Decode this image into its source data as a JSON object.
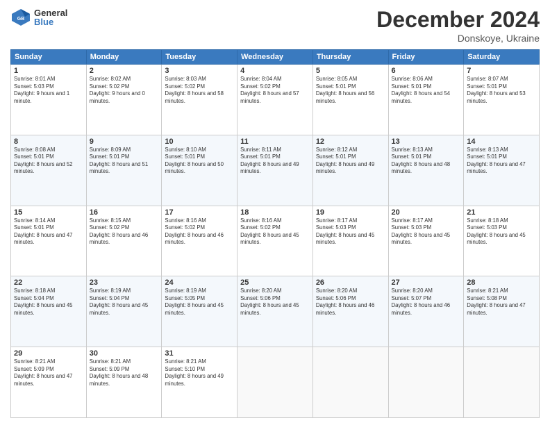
{
  "header": {
    "logo_general": "General",
    "logo_blue": "Blue",
    "title": "December 2024",
    "subtitle": "Donskoye, Ukraine"
  },
  "days_of_week": [
    "Sunday",
    "Monday",
    "Tuesday",
    "Wednesday",
    "Thursday",
    "Friday",
    "Saturday"
  ],
  "weeks": [
    [
      {
        "day": "1",
        "sunrise": "Sunrise: 8:01 AM",
        "sunset": "Sunset: 5:03 PM",
        "daylight": "Daylight: 9 hours and 1 minute."
      },
      {
        "day": "2",
        "sunrise": "Sunrise: 8:02 AM",
        "sunset": "Sunset: 5:02 PM",
        "daylight": "Daylight: 9 hours and 0 minutes."
      },
      {
        "day": "3",
        "sunrise": "Sunrise: 8:03 AM",
        "sunset": "Sunset: 5:02 PM",
        "daylight": "Daylight: 8 hours and 58 minutes."
      },
      {
        "day": "4",
        "sunrise": "Sunrise: 8:04 AM",
        "sunset": "Sunset: 5:02 PM",
        "daylight": "Daylight: 8 hours and 57 minutes."
      },
      {
        "day": "5",
        "sunrise": "Sunrise: 8:05 AM",
        "sunset": "Sunset: 5:01 PM",
        "daylight": "Daylight: 8 hours and 56 minutes."
      },
      {
        "day": "6",
        "sunrise": "Sunrise: 8:06 AM",
        "sunset": "Sunset: 5:01 PM",
        "daylight": "Daylight: 8 hours and 54 minutes."
      },
      {
        "day": "7",
        "sunrise": "Sunrise: 8:07 AM",
        "sunset": "Sunset: 5:01 PM",
        "daylight": "Daylight: 8 hours and 53 minutes."
      }
    ],
    [
      {
        "day": "8",
        "sunrise": "Sunrise: 8:08 AM",
        "sunset": "Sunset: 5:01 PM",
        "daylight": "Daylight: 8 hours and 52 minutes."
      },
      {
        "day": "9",
        "sunrise": "Sunrise: 8:09 AM",
        "sunset": "Sunset: 5:01 PM",
        "daylight": "Daylight: 8 hours and 51 minutes."
      },
      {
        "day": "10",
        "sunrise": "Sunrise: 8:10 AM",
        "sunset": "Sunset: 5:01 PM",
        "daylight": "Daylight: 8 hours and 50 minutes."
      },
      {
        "day": "11",
        "sunrise": "Sunrise: 8:11 AM",
        "sunset": "Sunset: 5:01 PM",
        "daylight": "Daylight: 8 hours and 49 minutes."
      },
      {
        "day": "12",
        "sunrise": "Sunrise: 8:12 AM",
        "sunset": "Sunset: 5:01 PM",
        "daylight": "Daylight: 8 hours and 49 minutes."
      },
      {
        "day": "13",
        "sunrise": "Sunrise: 8:13 AM",
        "sunset": "Sunset: 5:01 PM",
        "daylight": "Daylight: 8 hours and 48 minutes."
      },
      {
        "day": "14",
        "sunrise": "Sunrise: 8:13 AM",
        "sunset": "Sunset: 5:01 PM",
        "daylight": "Daylight: 8 hours and 47 minutes."
      }
    ],
    [
      {
        "day": "15",
        "sunrise": "Sunrise: 8:14 AM",
        "sunset": "Sunset: 5:01 PM",
        "daylight": "Daylight: 8 hours and 47 minutes."
      },
      {
        "day": "16",
        "sunrise": "Sunrise: 8:15 AM",
        "sunset": "Sunset: 5:02 PM",
        "daylight": "Daylight: 8 hours and 46 minutes."
      },
      {
        "day": "17",
        "sunrise": "Sunrise: 8:16 AM",
        "sunset": "Sunset: 5:02 PM",
        "daylight": "Daylight: 8 hours and 46 minutes."
      },
      {
        "day": "18",
        "sunrise": "Sunrise: 8:16 AM",
        "sunset": "Sunset: 5:02 PM",
        "daylight": "Daylight: 8 hours and 45 minutes."
      },
      {
        "day": "19",
        "sunrise": "Sunrise: 8:17 AM",
        "sunset": "Sunset: 5:03 PM",
        "daylight": "Daylight: 8 hours and 45 minutes."
      },
      {
        "day": "20",
        "sunrise": "Sunrise: 8:17 AM",
        "sunset": "Sunset: 5:03 PM",
        "daylight": "Daylight: 8 hours and 45 minutes."
      },
      {
        "day": "21",
        "sunrise": "Sunrise: 8:18 AM",
        "sunset": "Sunset: 5:03 PM",
        "daylight": "Daylight: 8 hours and 45 minutes."
      }
    ],
    [
      {
        "day": "22",
        "sunrise": "Sunrise: 8:18 AM",
        "sunset": "Sunset: 5:04 PM",
        "daylight": "Daylight: 8 hours and 45 minutes."
      },
      {
        "day": "23",
        "sunrise": "Sunrise: 8:19 AM",
        "sunset": "Sunset: 5:04 PM",
        "daylight": "Daylight: 8 hours and 45 minutes."
      },
      {
        "day": "24",
        "sunrise": "Sunrise: 8:19 AM",
        "sunset": "Sunset: 5:05 PM",
        "daylight": "Daylight: 8 hours and 45 minutes."
      },
      {
        "day": "25",
        "sunrise": "Sunrise: 8:20 AM",
        "sunset": "Sunset: 5:06 PM",
        "daylight": "Daylight: 8 hours and 45 minutes."
      },
      {
        "day": "26",
        "sunrise": "Sunrise: 8:20 AM",
        "sunset": "Sunset: 5:06 PM",
        "daylight": "Daylight: 8 hours and 46 minutes."
      },
      {
        "day": "27",
        "sunrise": "Sunrise: 8:20 AM",
        "sunset": "Sunset: 5:07 PM",
        "daylight": "Daylight: 8 hours and 46 minutes."
      },
      {
        "day": "28",
        "sunrise": "Sunrise: 8:21 AM",
        "sunset": "Sunset: 5:08 PM",
        "daylight": "Daylight: 8 hours and 47 minutes."
      }
    ],
    [
      {
        "day": "29",
        "sunrise": "Sunrise: 8:21 AM",
        "sunset": "Sunset: 5:09 PM",
        "daylight": "Daylight: 8 hours and 47 minutes."
      },
      {
        "day": "30",
        "sunrise": "Sunrise: 8:21 AM",
        "sunset": "Sunset: 5:09 PM",
        "daylight": "Daylight: 8 hours and 48 minutes."
      },
      {
        "day": "31",
        "sunrise": "Sunrise: 8:21 AM",
        "sunset": "Sunset: 5:10 PM",
        "daylight": "Daylight: 8 hours and 49 minutes."
      },
      null,
      null,
      null,
      null
    ]
  ]
}
